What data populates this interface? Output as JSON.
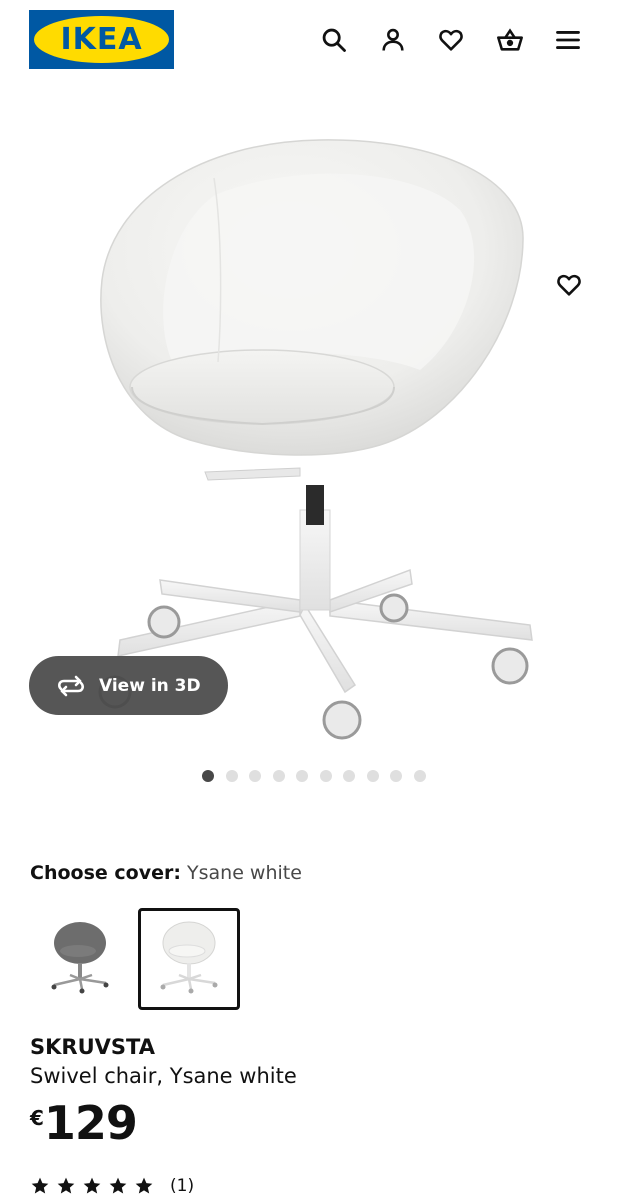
{
  "header": {
    "logo_text": "IKEA",
    "icons": [
      "search-icon",
      "account-icon",
      "favourites-icon",
      "basket-icon",
      "menu-icon"
    ]
  },
  "gallery": {
    "view_3d_label": "View in 3D",
    "image_count": 10,
    "active_index": 0
  },
  "cover": {
    "label": "Choose cover:",
    "value": "Ysane white",
    "options": [
      "Gray",
      "Ysane white"
    ],
    "selected_index": 1
  },
  "product": {
    "name": "SKRUVSTA",
    "description": "Swivel chair, Ysane white",
    "currency": "€",
    "price": "129",
    "rating_stars": 5,
    "review_count": "(1)"
  },
  "colors": {
    "brand_blue": "#0058a3",
    "brand_yellow": "#ffdb00",
    "pill_background": "#484848"
  }
}
